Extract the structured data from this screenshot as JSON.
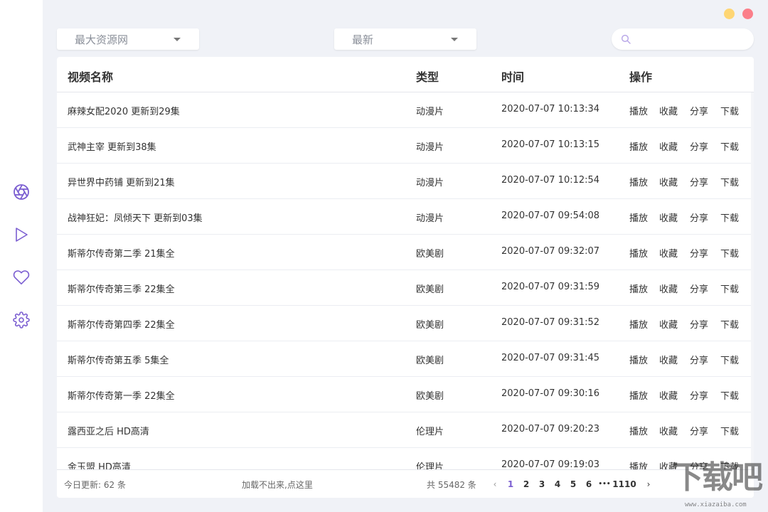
{
  "window": {
    "minimize_color": "#fed674",
    "close_color": "#fb7f8a"
  },
  "sidebar": {
    "accent": "#7b5ed1",
    "items": [
      {
        "icon": "aperture-icon",
        "active": true
      },
      {
        "icon": "play-icon",
        "active": false
      },
      {
        "icon": "heart-icon",
        "active": false
      },
      {
        "icon": "settings-icon",
        "active": false
      }
    ]
  },
  "filters": {
    "source": "最大资源网",
    "sort": "最新"
  },
  "search": {
    "value": "",
    "placeholder": ""
  },
  "table": {
    "headers": {
      "name": "视频名称",
      "type": "类型",
      "time": "时间",
      "ops": "操作"
    },
    "actions": {
      "play": "播放",
      "favorite": "收藏",
      "share": "分享",
      "download": "下载"
    },
    "rows": [
      {
        "name": "麻辣女配2020 更新到29集",
        "type": "动漫片",
        "time": "2020-07-07 10:13:34"
      },
      {
        "name": "武神主宰 更新到38集",
        "type": "动漫片",
        "time": "2020-07-07 10:13:15"
      },
      {
        "name": "异世界中药铺 更新到21集",
        "type": "动漫片",
        "time": "2020-07-07 10:12:54"
      },
      {
        "name": "战神狂妃：凤倾天下 更新到03集",
        "type": "动漫片",
        "time": "2020-07-07 09:54:08"
      },
      {
        "name": "斯蒂尔传奇第二季 21集全",
        "type": "欧美剧",
        "time": "2020-07-07 09:32:07"
      },
      {
        "name": "斯蒂尔传奇第三季 22集全",
        "type": "欧美剧",
        "time": "2020-07-07 09:31:59"
      },
      {
        "name": "斯蒂尔传奇第四季 22集全",
        "type": "欧美剧",
        "time": "2020-07-07 09:31:52"
      },
      {
        "name": "斯蒂尔传奇第五季 5集全",
        "type": "欧美剧",
        "time": "2020-07-07 09:31:45"
      },
      {
        "name": "斯蒂尔传奇第一季 22集全",
        "type": "欧美剧",
        "time": "2020-07-07 09:30:16"
      },
      {
        "name": "露西亚之后 HD高清",
        "type": "伦理片",
        "time": "2020-07-07 09:20:23"
      },
      {
        "name": "金玉盟 HD高清",
        "type": "伦理片",
        "time": "2020-07-07 09:19:03"
      }
    ]
  },
  "footer": {
    "today": "今日更新: 62 条",
    "reload": "加载不出来,点这里",
    "total": "共 55482 条",
    "pages": [
      "1",
      "2",
      "3",
      "4",
      "5",
      "6"
    ],
    "current_page": "1",
    "ellipsis": "•••",
    "last_page": "1110",
    "prev": "‹",
    "next": "›"
  },
  "watermark": {
    "text": "下载吧",
    "url": "www.xiazaiba.com"
  }
}
